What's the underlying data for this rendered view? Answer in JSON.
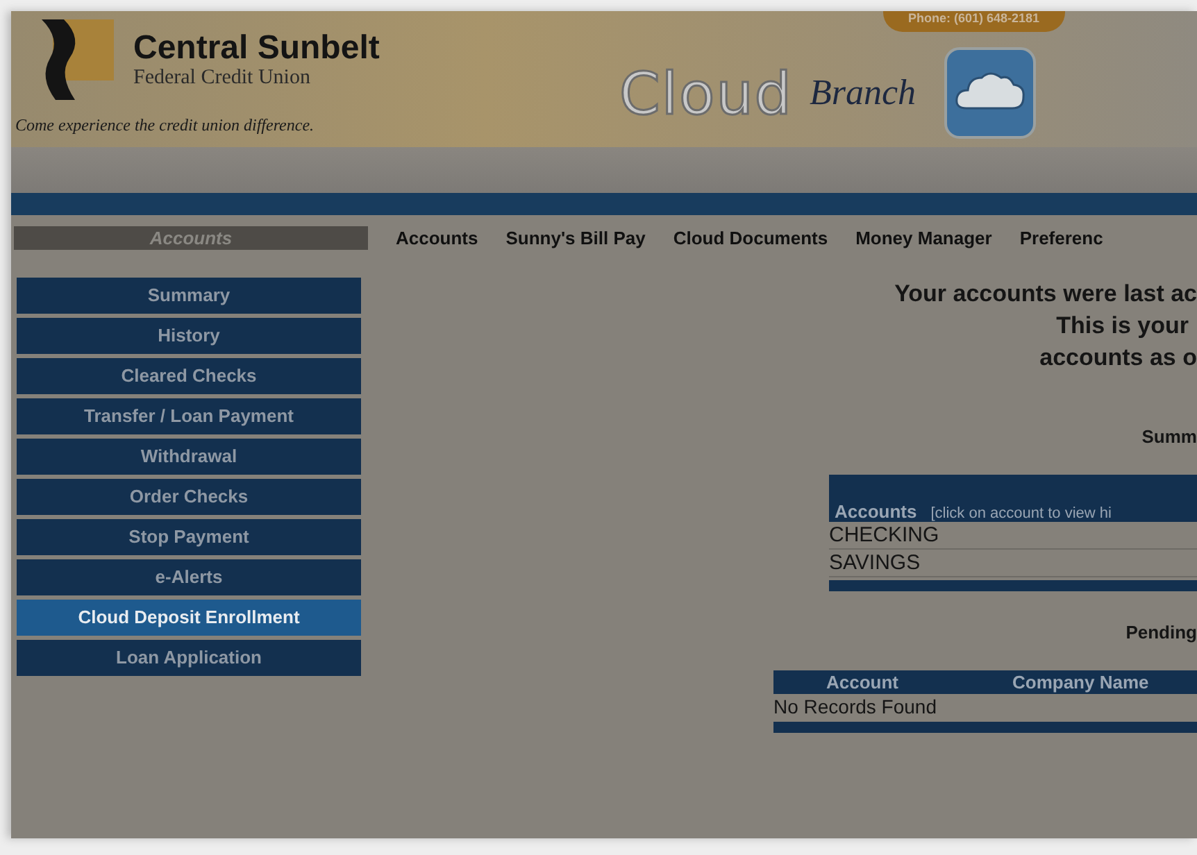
{
  "header": {
    "brand_name": "Central Sunbelt",
    "brand_subtitle": "Federal Credit Union",
    "tagline": "Come experience the credit union difference.",
    "phone": "Phone: (601) 648-2181",
    "title_main": "Cloud",
    "title_script": "Branch"
  },
  "nav": [
    "Accounts",
    "Sunny's Bill Pay",
    "Cloud Documents",
    "Money Manager",
    "Preferenc"
  ],
  "sidebar": {
    "title": "Accounts",
    "items": [
      {
        "label": "Summary",
        "selected": false
      },
      {
        "label": "History",
        "selected": false
      },
      {
        "label": "Cleared Checks",
        "selected": false
      },
      {
        "label": "Transfer / Loan Payment",
        "selected": false
      },
      {
        "label": "Withdrawal",
        "selected": false
      },
      {
        "label": "Order Checks",
        "selected": false
      },
      {
        "label": "Stop Payment",
        "selected": false
      },
      {
        "label": "e-Alerts",
        "selected": false
      },
      {
        "label": "Cloud Deposit Enrollment",
        "selected": true
      },
      {
        "label": "Loan Application",
        "selected": false
      }
    ]
  },
  "main": {
    "intro_lines": [
      "Your accounts were last ac",
      "This is your",
      "accounts as o"
    ],
    "summary_heading": "Summ",
    "accounts_table": {
      "header_label": "Accounts",
      "header_hint": "[click on account to view hi",
      "rows": [
        "CHECKING",
        "SAVINGS"
      ]
    },
    "pending_heading": "Pending",
    "pending_table": {
      "columns": [
        "Account",
        "Company Name"
      ],
      "empty_message": "No Records Found"
    }
  }
}
